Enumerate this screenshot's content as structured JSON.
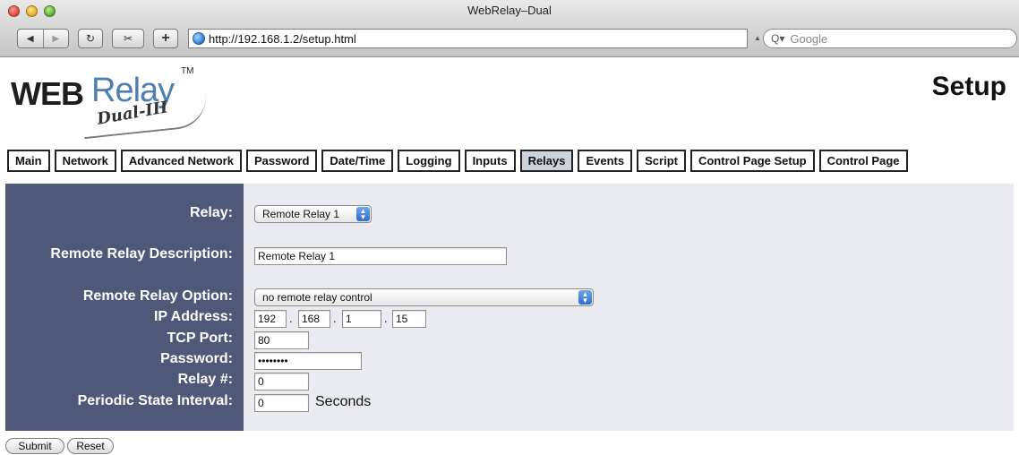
{
  "window": {
    "title": "WebRelay–Dual"
  },
  "toolbar": {
    "back_icon": "back-arrow-icon",
    "forward_icon": "forward-arrow-icon",
    "reload_label": "↻",
    "snapback_label": "✂",
    "add_bookmark_label": "+",
    "url": "http://192.168.1.2/setup.html",
    "search_placeholder": "Google"
  },
  "header": {
    "logo_web": "WEB",
    "logo_relay": "Relay",
    "logo_tm": "TM",
    "logo_sub": "Dual-III",
    "page_title": "Setup"
  },
  "tabs": [
    {
      "label": "Main"
    },
    {
      "label": "Network"
    },
    {
      "label": "Advanced Network"
    },
    {
      "label": "Password"
    },
    {
      "label": "Date/Time"
    },
    {
      "label": "Logging"
    },
    {
      "label": "Inputs"
    },
    {
      "label": "Relays",
      "active": true
    },
    {
      "label": "Events"
    },
    {
      "label": "Script"
    },
    {
      "label": "Control Page Setup"
    },
    {
      "label": "Control Page"
    }
  ],
  "form": {
    "relay_label": "Relay:",
    "relay_value": "Remote Relay 1",
    "description_label": "Remote Relay Description:",
    "description_value": "Remote Relay 1",
    "option_label": "Remote Relay Option:",
    "option_value": "no remote relay control",
    "ip_label": "IP Address:",
    "ip_octets": [
      "192",
      "168",
      "1",
      "15"
    ],
    "port_label": "TCP Port:",
    "port_value": "80",
    "password_label": "Password:",
    "password_value": "••••••••",
    "relay_num_label": "Relay #:",
    "relay_num_value": "0",
    "interval_label": "Periodic State Interval:",
    "interval_value": "0",
    "interval_unit": "Seconds"
  },
  "buttons": {
    "submit": "Submit",
    "reset": "Reset"
  },
  "colors": {
    "panel_label_bg": "#50587a",
    "panel_bg": "#e9ebf0",
    "logo_blue": "#4e7fb1"
  }
}
